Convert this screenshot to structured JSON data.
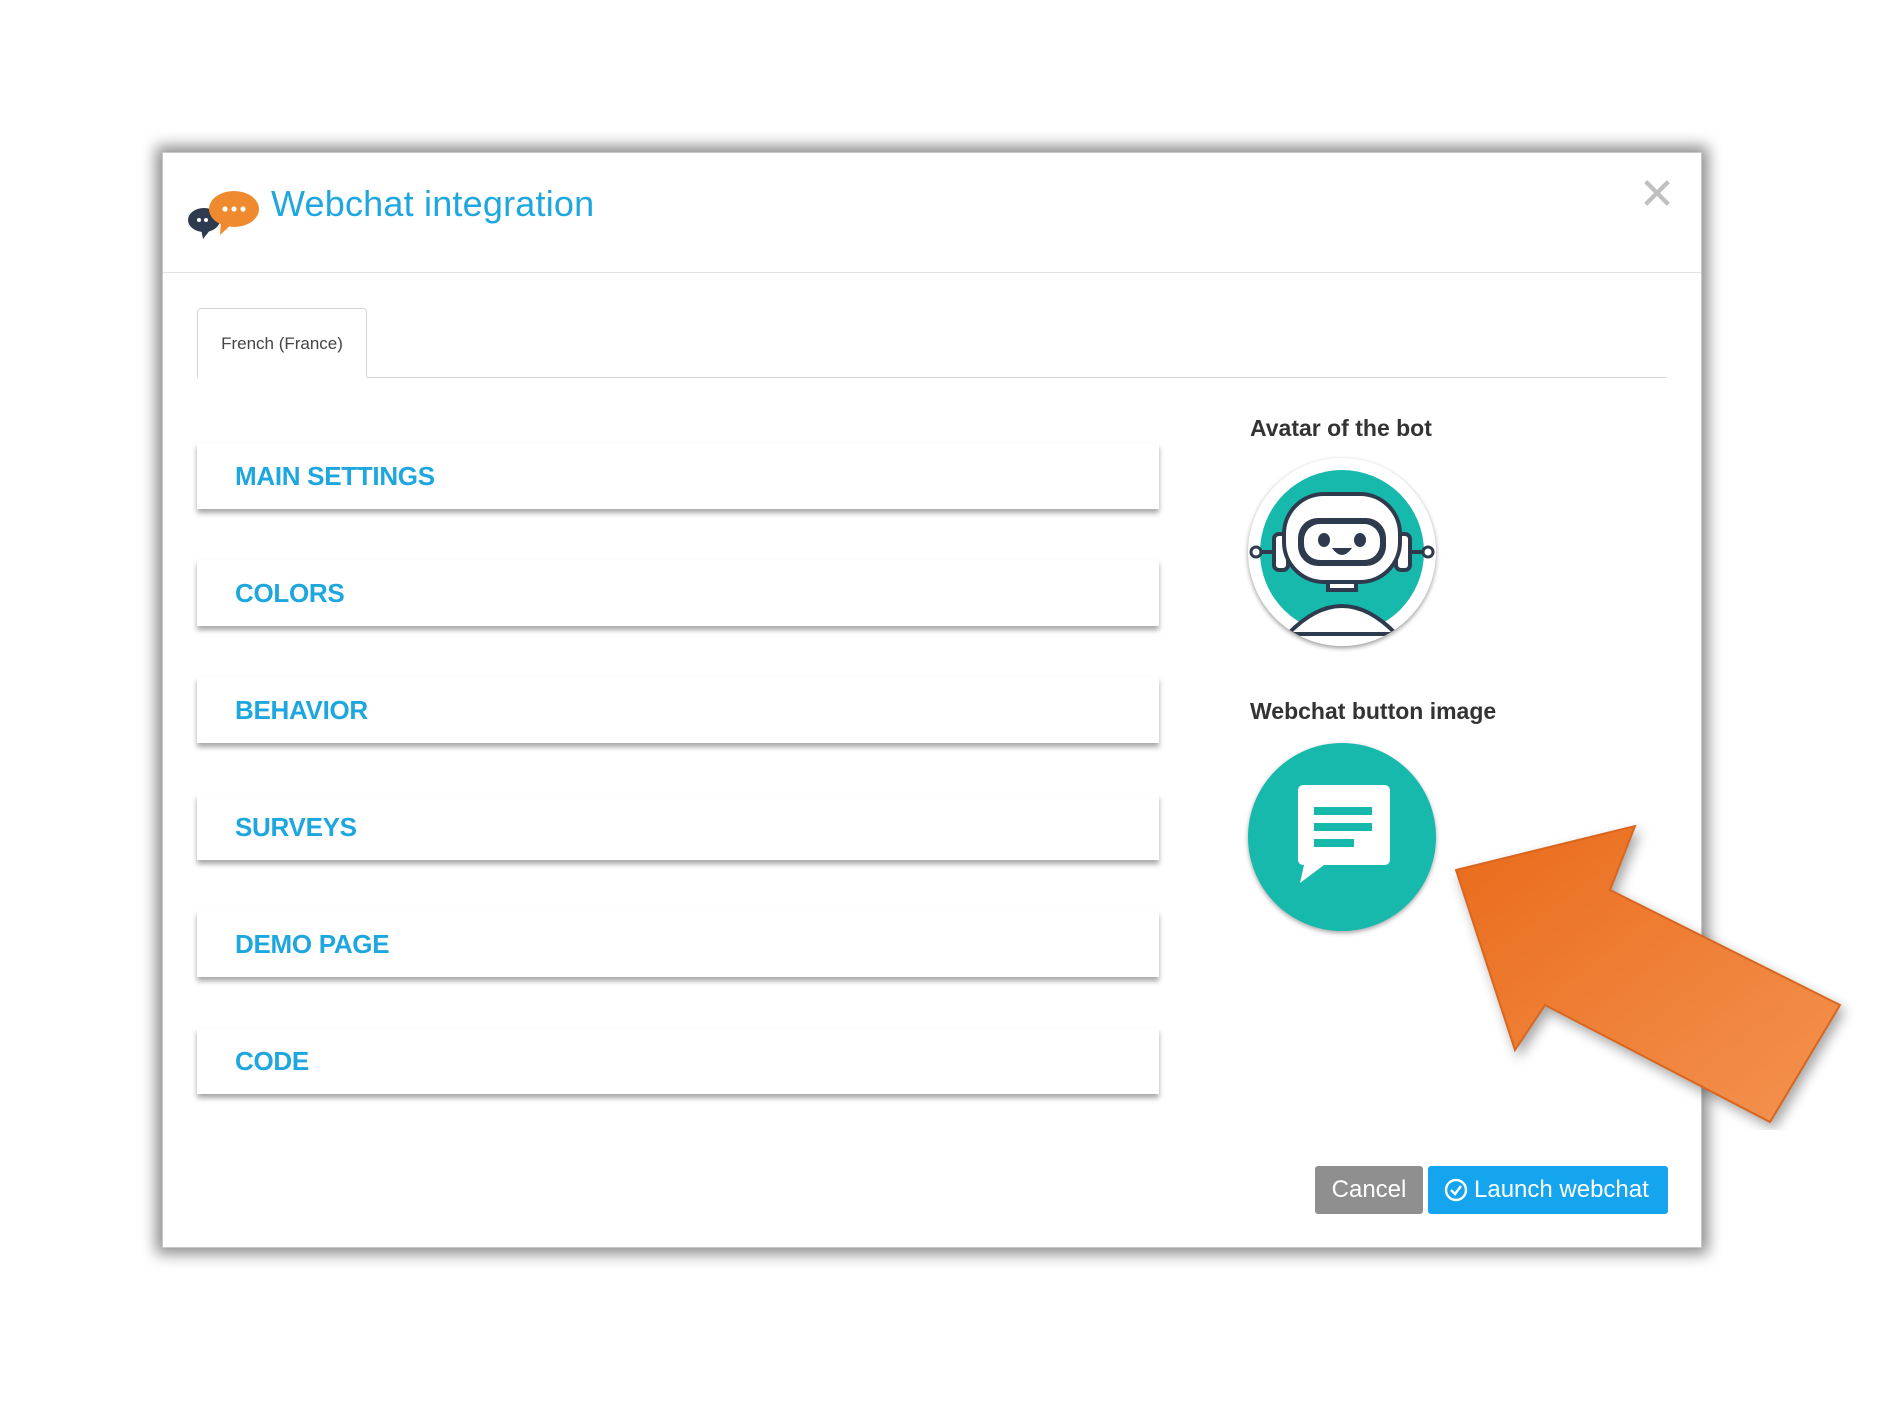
{
  "modal": {
    "title": "Webchat integration",
    "close_symbol": "✕"
  },
  "tabs": [
    {
      "label": "French (France)",
      "active": true
    }
  ],
  "sections": [
    {
      "label": "MAIN SETTINGS"
    },
    {
      "label": "COLORS"
    },
    {
      "label": "BEHAVIOR"
    },
    {
      "label": "SURVEYS"
    },
    {
      "label": "DEMO PAGE"
    },
    {
      "label": "CODE"
    }
  ],
  "images": {
    "avatar_label": "Avatar of the bot",
    "avatar_icon": "robot-avatar-icon",
    "button_image_label": "Webchat button image",
    "button_image_icon": "chat-bubble-icon"
  },
  "footer": {
    "cancel_label": "Cancel",
    "launch_label": "Launch webchat"
  },
  "colors": {
    "accent_blue": "#1ea7df",
    "launch_blue": "#15a5ee",
    "cancel_gray": "#8f8f8f",
    "teal": "#17b9ad",
    "logo_orange": "#ef8a2f",
    "logo_dark": "#2e3b4e",
    "arrow_orange": "#ee7525"
  }
}
